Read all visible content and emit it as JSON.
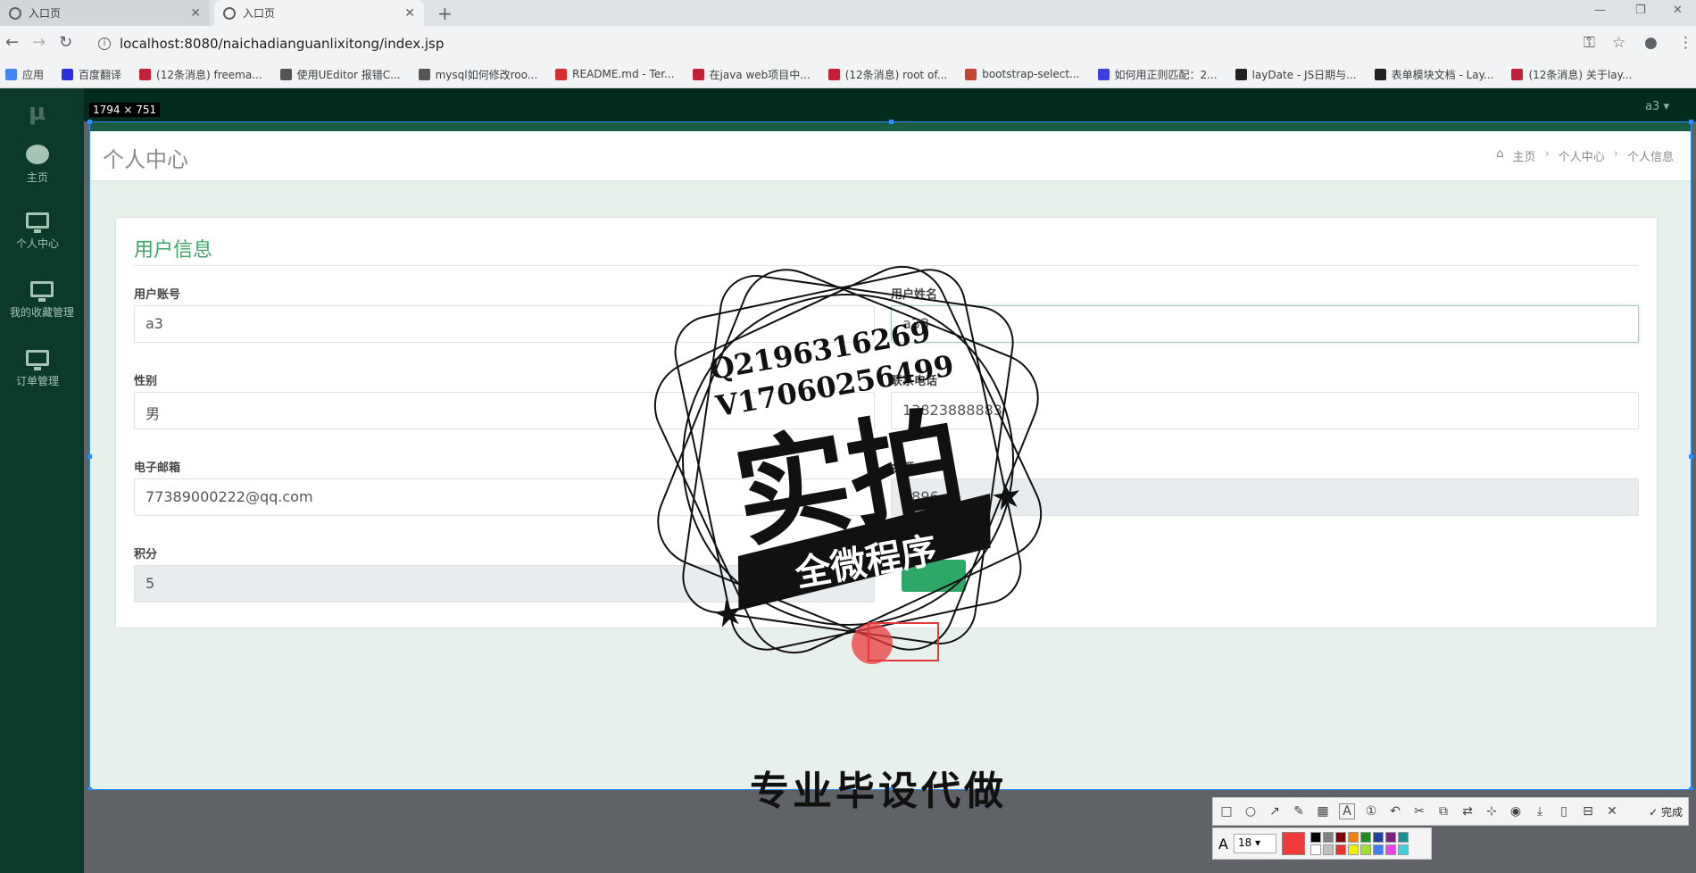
{
  "browser": {
    "tabs": [
      {
        "label": "入口页",
        "active": false
      },
      {
        "label": "入口页",
        "active": true
      }
    ],
    "url": "localhost:8080/naichadianguanlixitong/index.jsp",
    "bookmarks": [
      {
        "label": "应用",
        "color": "#4285f4"
      },
      {
        "label": "百度翻译",
        "color": "#2932e1"
      },
      {
        "label": "(12条消息) freema...",
        "color": "#c32136"
      },
      {
        "label": "使用UEditor 报错C...",
        "color": "#555555"
      },
      {
        "label": "mysql如何修改roo...",
        "color": "#555555"
      },
      {
        "label": "README.md - Ter...",
        "color": "#d32f2f"
      },
      {
        "label": "在java web项目中...",
        "color": "#c32136"
      },
      {
        "label": "(12条消息) root of...",
        "color": "#c32136"
      },
      {
        "label": "bootstrap-select...",
        "color": "#c2452d"
      },
      {
        "label": "如何用正则匹配：2...",
        "color": "#3b3fe0"
      },
      {
        "label": "layDate - JS日期与...",
        "color": "#222222"
      },
      {
        "label": "表单模块文档 - Lay...",
        "color": "#222222"
      },
      {
        "label": "(12条消息) 关于lay...",
        "color": "#c32136"
      }
    ]
  },
  "app": {
    "logo": "μ",
    "nav": [
      {
        "label": "主页",
        "icon": "dashboard-icon"
      },
      {
        "label": "个人中心",
        "icon": "monitor-icon"
      },
      {
        "label": "我的收藏管理",
        "icon": "monitor-icon"
      },
      {
        "label": "订单管理",
        "icon": "monitor-icon"
      }
    ],
    "dimension_label": "1794 × 751",
    "user_menu": "a3 ▾",
    "page_title": "个人中心",
    "breadcrumb": {
      "home": "主页",
      "level1": "个人中心",
      "level2": "个人信息"
    },
    "card_title": "用户信息",
    "form": {
      "account_label": "用户账号",
      "account_value": "a3",
      "name_label": "用户姓名",
      "name_value": "a33",
      "gender_label": "性别",
      "gender_value": "男",
      "phone_label": "联系电话",
      "phone_value": "13823888883",
      "email_label": "电子邮箱",
      "email_value": "77389000222@qq.com",
      "balance_label": "余额",
      "balance_value": "1896",
      "points_label": "积分",
      "points_value": "5"
    },
    "accent_color": "#3fa46a"
  },
  "watermark": {
    "qq": "Q2196316269",
    "wechat": "V17060256499",
    "big": "实拍",
    "banner": "全微程序"
  },
  "overlay": {
    "bottom_text": "专业毕设代做",
    "font_size": "18",
    "done_label": "完成"
  }
}
